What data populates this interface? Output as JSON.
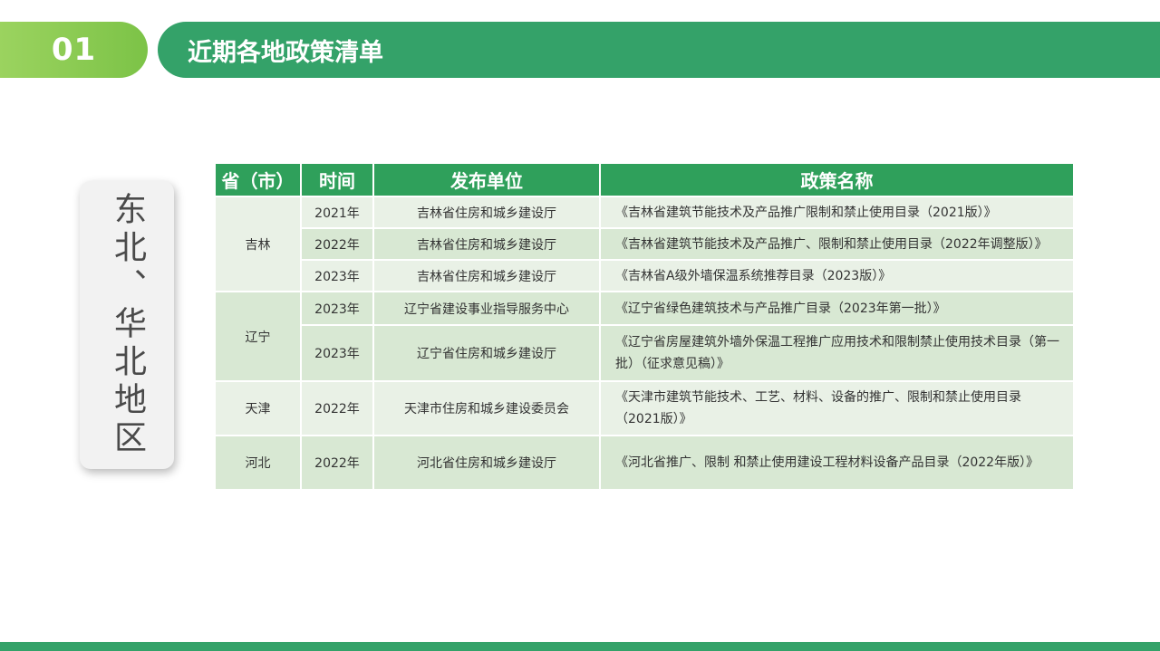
{
  "header": {
    "number": "01",
    "title": "近期各地政策清单"
  },
  "region": {
    "label": "东北、华北地区"
  },
  "table": {
    "headers": [
      "省（市）",
      "时间",
      "发布单位",
      "政策名称"
    ],
    "groups": [
      {
        "province": "吉林",
        "rows": [
          {
            "year": "2021年",
            "org": "吉林省住房和城乡建设厅",
            "name": "《吉林省建筑节能技术及产品推广限制和禁止使用目录（2021版）》"
          },
          {
            "year": "2022年",
            "org": "吉林省住房和城乡建设厅",
            "name": "《吉林省建筑节能技术及产品推广、限制和禁止使用目录（2022年调整版）》"
          },
          {
            "year": "2023年",
            "org": "吉林省住房和城乡建设厅",
            "name": "《吉林省A级外墙保温系统推荐目录（2023版）》"
          }
        ]
      },
      {
        "province": "辽宁",
        "rows": [
          {
            "year": "2023年",
            "org": "辽宁省建设事业指导服务中心",
            "name": "《辽宁省绿色建筑技术与产品推广目录（2023年第一批）》"
          },
          {
            "year": "2023年",
            "org": "辽宁省住房和城乡建设厅",
            "name": "《辽宁省房屋建筑外墙外保温工程推广应用技术和限制禁止使用技术目录（第一批）（征求意见稿）》"
          }
        ]
      },
      {
        "province": "天津",
        "rows": [
          {
            "year": "2022年",
            "org": "天津市住房和城乡建设委员会",
            "name": "《天津市建筑节能技术、工艺、材料、设备的推广、限制和禁止使用目录（2021版）》"
          }
        ]
      },
      {
        "province": "河北",
        "rows": [
          {
            "year": "2022年",
            "org": "河北省住房和城乡建设厅",
            "name": "《河北省推广、限制 和禁止使用建设工程材料设备产品目录（2022年版）》"
          }
        ]
      }
    ]
  },
  "colors": {
    "accent_green": "#34a269",
    "light_green": "#7cc347",
    "row_light": "#e9f1e6",
    "row_dark": "#d8e8d3"
  }
}
